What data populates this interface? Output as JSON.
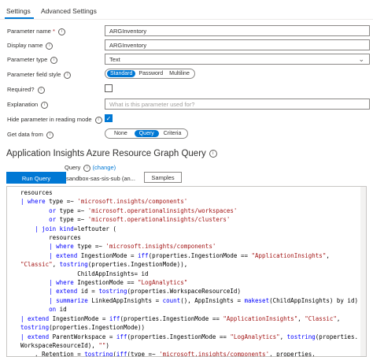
{
  "tabs": {
    "settings": "Settings",
    "advanced": "Advanced Settings"
  },
  "form": {
    "parameter_name": {
      "label": "Parameter name",
      "required_mark": "*",
      "value": "ARGInventory"
    },
    "display_name": {
      "label": "Display name",
      "value": "ARGInventory"
    },
    "parameter_type": {
      "label": "Parameter type",
      "value": "Text"
    },
    "field_style": {
      "label": "Parameter field style",
      "options": [
        "Standard",
        "Password",
        "Multiline"
      ],
      "selected": "Standard"
    },
    "required": {
      "label": "Required?",
      "checked": false
    },
    "explanation": {
      "label": "Explanation",
      "placeholder": "What is this parameter used for?"
    },
    "hide_in_reading": {
      "label": "Hide parameter in reading mode",
      "checked": true
    },
    "get_data_from": {
      "label": "Get data from",
      "options": [
        "None",
        "Query",
        "Criteria"
      ],
      "selected": "Query"
    }
  },
  "query_section": {
    "title": "Application Insights Azure Resource Graph Query",
    "query_label": "Query",
    "change_link": "(change)",
    "run_button": "Run Query",
    "source": "sandbox-sas-sis-sub (an...",
    "samples_button": "Samples"
  },
  "code_lines": [
    "resources",
    "| where type =~ 'microsoft.insights/components'",
    "        or type =~ 'microsoft.operationalinsights/workspaces'",
    "        or type =~ 'microsoft.operationalinsights/clusters'",
    "    | join kind=leftouter (",
    "        resources",
    "        | where type =~ 'microsoft.insights/components'",
    "        | extend IngestionMode = iff(properties.IngestionMode == \"ApplicationInsights\",",
    "\"Classic\", tostring(properties.IngestionMode)),",
    "                ChildAppInsights= id",
    "        | where IngestionMode == \"LogAnalytics\"",
    "        | extend id = tostring(properties.WorkspaceResourceId)",
    "        | summarize LinkedAppInsights = count(), AppInsights = makeset(ChildAppInsights) by id)",
    "        on id",
    "| extend IngestionMode = iff(properties.IngestionMode == \"ApplicationInsights\", \"Classic\",",
    "tostring(properties.IngestionMode))",
    "| extend ParentWorkspace = iff(properties.IngestionMode == \"LogAnalytics\", tostring(properties.",
    "WorkspaceResourceId), \"\")",
    "    , Retention = tostring(iff(type =~ 'microsoft.insights/components', properties."
  ]
}
